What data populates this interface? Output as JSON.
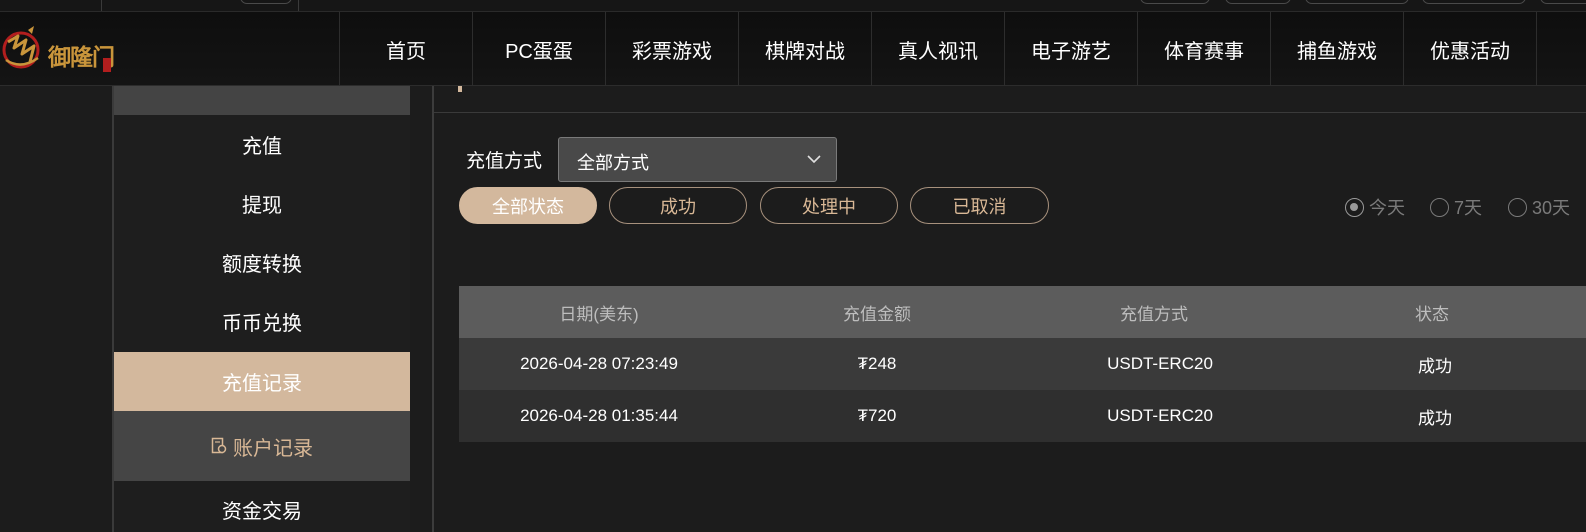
{
  "header": {
    "logo_text": "御隆门",
    "nav": [
      "首页",
      "PC蛋蛋",
      "彩票游戏",
      "棋牌对战",
      "真人视讯",
      "电子游艺",
      "体育赛事",
      "捕鱼游戏",
      "优惠活动"
    ]
  },
  "sidebar": {
    "items": [
      "充值",
      "提现",
      "额度转换",
      "币币兑换",
      "充值记录"
    ],
    "active_item": "充值记录",
    "section2_label": "账户记录",
    "section2_items": [
      "资金交易"
    ]
  },
  "main": {
    "method_label": "充值方式",
    "method_value": "全部方式",
    "status_filters": [
      "全部状态",
      "成功",
      "处理中",
      "已取消"
    ],
    "active_status": "全部状态",
    "date_ranges": [
      "今天",
      "7天",
      "30天"
    ],
    "selected_date_range": "今天",
    "table": {
      "headers": [
        "日期(美东)",
        "充值金额",
        "充值方式",
        "状态"
      ],
      "rows": [
        [
          "2026-04-28 07:23:49",
          "₮248",
          "USDT-ERC20",
          "成功"
        ],
        [
          "2026-04-28 01:35:44",
          "₮720",
          "USDT-ERC20",
          "成功"
        ]
      ]
    }
  },
  "colors": {
    "accent": "#d3b89d",
    "accent_text": "#d9b896",
    "header_bg": "#111111",
    "table_header_bg": "#5c5c5c"
  }
}
